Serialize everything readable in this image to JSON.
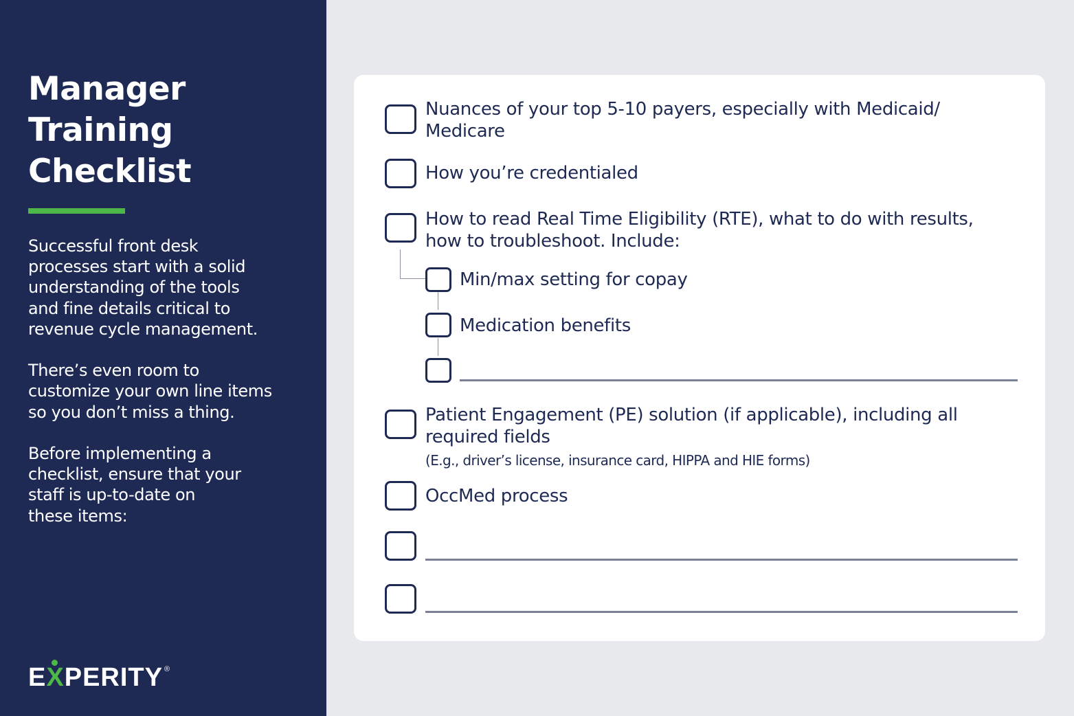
{
  "sidebar": {
    "title_lines": [
      "Manager",
      "Training",
      "Checklist"
    ],
    "paragraphs": [
      "Successful front desk\nprocesses start with a solid\nunderstanding of the tools\nand fine details critical to\nrevenue cycle management.",
      "There’s even room to\ncustomize your own line items\nso you don’t miss a thing.",
      "Before implementing a\nchecklist, ensure that your\nstaff is up-to-date on\nthese items:"
    ],
    "logo": {
      "prefix": "E",
      "accent_letter": "X",
      "suffix": "PERITY",
      "registered": "®"
    },
    "colors": {
      "background": "#1e2a54",
      "accent": "#4db848"
    }
  },
  "checklist": {
    "items": [
      {
        "label": "Nuances of your top 5-10 payers, especially with Medicaid/\nMedicare",
        "checked": false
      },
      {
        "label": "How you’re credentialed",
        "checked": false
      },
      {
        "label": "How to read Real Time Eligibility (RTE), what to do with results,\nhow to troubleshoot. Include:",
        "checked": false,
        "sub_items": [
          {
            "label": "Min/max setting for copay",
            "checked": false
          },
          {
            "label": "Medication benefits",
            "checked": false
          },
          {
            "label": "",
            "checked": false,
            "blank": true
          }
        ]
      },
      {
        "label": "Patient Engagement (PE) solution (if applicable), including all\nrequired fields",
        "note": "(E.g., driver’s license, insurance card, HIPPA and HIE forms)",
        "checked": false
      },
      {
        "label": "OccMed process",
        "checked": false
      },
      {
        "label": "",
        "checked": false,
        "blank": true
      },
      {
        "label": "",
        "checked": false,
        "blank": true
      }
    ],
    "colors": {
      "text": "#1e2a54",
      "line": "#7a8196",
      "card": "#ffffff",
      "page": "#e8e9ed"
    }
  }
}
